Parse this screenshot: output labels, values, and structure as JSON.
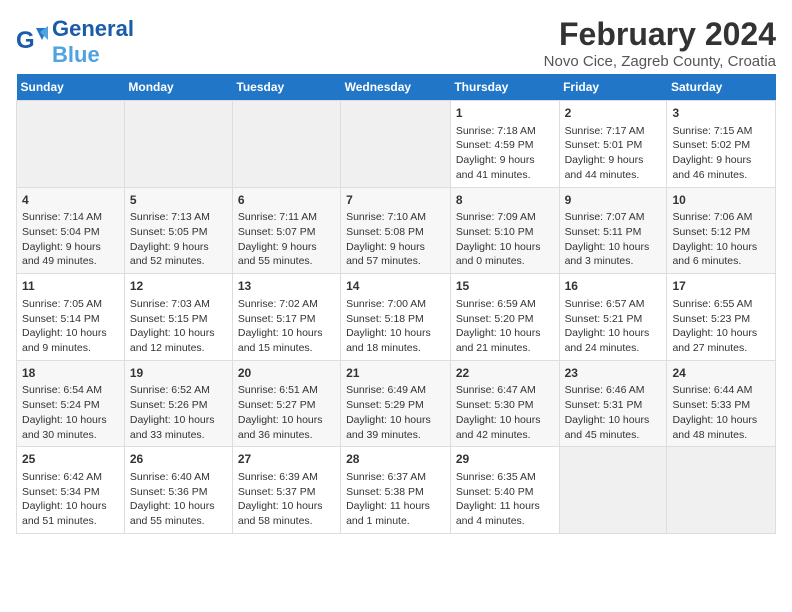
{
  "header": {
    "logo_general": "General",
    "logo_blue": "Blue",
    "title": "February 2024",
    "subtitle": "Novo Cice, Zagreb County, Croatia"
  },
  "calendar": {
    "days_of_week": [
      "Sunday",
      "Monday",
      "Tuesday",
      "Wednesday",
      "Thursday",
      "Friday",
      "Saturday"
    ],
    "weeks": [
      [
        {
          "day": "",
          "content": ""
        },
        {
          "day": "",
          "content": ""
        },
        {
          "day": "",
          "content": ""
        },
        {
          "day": "",
          "content": ""
        },
        {
          "day": "1",
          "content": "Sunrise: 7:18 AM\nSunset: 4:59 PM\nDaylight: 9 hours\nand 41 minutes."
        },
        {
          "day": "2",
          "content": "Sunrise: 7:17 AM\nSunset: 5:01 PM\nDaylight: 9 hours\nand 44 minutes."
        },
        {
          "day": "3",
          "content": "Sunrise: 7:15 AM\nSunset: 5:02 PM\nDaylight: 9 hours\nand 46 minutes."
        }
      ],
      [
        {
          "day": "4",
          "content": "Sunrise: 7:14 AM\nSunset: 5:04 PM\nDaylight: 9 hours\nand 49 minutes."
        },
        {
          "day": "5",
          "content": "Sunrise: 7:13 AM\nSunset: 5:05 PM\nDaylight: 9 hours\nand 52 minutes."
        },
        {
          "day": "6",
          "content": "Sunrise: 7:11 AM\nSunset: 5:07 PM\nDaylight: 9 hours\nand 55 minutes."
        },
        {
          "day": "7",
          "content": "Sunrise: 7:10 AM\nSunset: 5:08 PM\nDaylight: 9 hours\nand 57 minutes."
        },
        {
          "day": "8",
          "content": "Sunrise: 7:09 AM\nSunset: 5:10 PM\nDaylight: 10 hours\nand 0 minutes."
        },
        {
          "day": "9",
          "content": "Sunrise: 7:07 AM\nSunset: 5:11 PM\nDaylight: 10 hours\nand 3 minutes."
        },
        {
          "day": "10",
          "content": "Sunrise: 7:06 AM\nSunset: 5:12 PM\nDaylight: 10 hours\nand 6 minutes."
        }
      ],
      [
        {
          "day": "11",
          "content": "Sunrise: 7:05 AM\nSunset: 5:14 PM\nDaylight: 10 hours\nand 9 minutes."
        },
        {
          "day": "12",
          "content": "Sunrise: 7:03 AM\nSunset: 5:15 PM\nDaylight: 10 hours\nand 12 minutes."
        },
        {
          "day": "13",
          "content": "Sunrise: 7:02 AM\nSunset: 5:17 PM\nDaylight: 10 hours\nand 15 minutes."
        },
        {
          "day": "14",
          "content": "Sunrise: 7:00 AM\nSunset: 5:18 PM\nDaylight: 10 hours\nand 18 minutes."
        },
        {
          "day": "15",
          "content": "Sunrise: 6:59 AM\nSunset: 5:20 PM\nDaylight: 10 hours\nand 21 minutes."
        },
        {
          "day": "16",
          "content": "Sunrise: 6:57 AM\nSunset: 5:21 PM\nDaylight: 10 hours\nand 24 minutes."
        },
        {
          "day": "17",
          "content": "Sunrise: 6:55 AM\nSunset: 5:23 PM\nDaylight: 10 hours\nand 27 minutes."
        }
      ],
      [
        {
          "day": "18",
          "content": "Sunrise: 6:54 AM\nSunset: 5:24 PM\nDaylight: 10 hours\nand 30 minutes."
        },
        {
          "day": "19",
          "content": "Sunrise: 6:52 AM\nSunset: 5:26 PM\nDaylight: 10 hours\nand 33 minutes."
        },
        {
          "day": "20",
          "content": "Sunrise: 6:51 AM\nSunset: 5:27 PM\nDaylight: 10 hours\nand 36 minutes."
        },
        {
          "day": "21",
          "content": "Sunrise: 6:49 AM\nSunset: 5:29 PM\nDaylight: 10 hours\nand 39 minutes."
        },
        {
          "day": "22",
          "content": "Sunrise: 6:47 AM\nSunset: 5:30 PM\nDaylight: 10 hours\nand 42 minutes."
        },
        {
          "day": "23",
          "content": "Sunrise: 6:46 AM\nSunset: 5:31 PM\nDaylight: 10 hours\nand 45 minutes."
        },
        {
          "day": "24",
          "content": "Sunrise: 6:44 AM\nSunset: 5:33 PM\nDaylight: 10 hours\nand 48 minutes."
        }
      ],
      [
        {
          "day": "25",
          "content": "Sunrise: 6:42 AM\nSunset: 5:34 PM\nDaylight: 10 hours\nand 51 minutes."
        },
        {
          "day": "26",
          "content": "Sunrise: 6:40 AM\nSunset: 5:36 PM\nDaylight: 10 hours\nand 55 minutes."
        },
        {
          "day": "27",
          "content": "Sunrise: 6:39 AM\nSunset: 5:37 PM\nDaylight: 10 hours\nand 58 minutes."
        },
        {
          "day": "28",
          "content": "Sunrise: 6:37 AM\nSunset: 5:38 PM\nDaylight: 11 hours\nand 1 minute."
        },
        {
          "day": "29",
          "content": "Sunrise: 6:35 AM\nSunset: 5:40 PM\nDaylight: 11 hours\nand 4 minutes."
        },
        {
          "day": "",
          "content": ""
        },
        {
          "day": "",
          "content": ""
        }
      ]
    ]
  }
}
